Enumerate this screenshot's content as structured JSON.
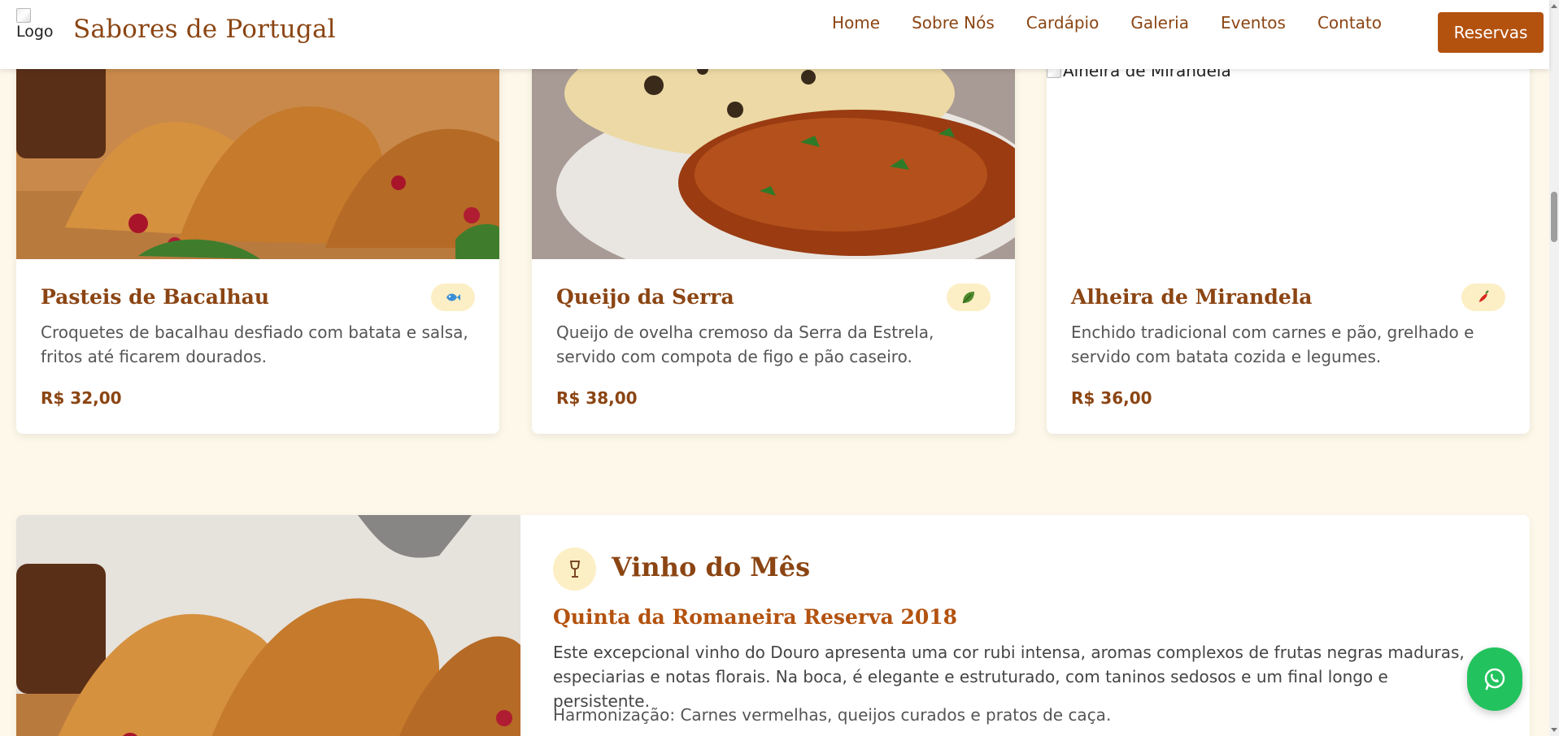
{
  "header": {
    "logo_alt": "Logo",
    "brand": "Sabores de Portugal",
    "nav": [
      "Home",
      "Sobre Nós",
      "Cardápio",
      "Galeria",
      "Eventos",
      "Contato"
    ],
    "cta": "Reservas"
  },
  "dishes": [
    {
      "name": "Pasteis de Bacalhau",
      "description": "Croquetes de bacalhau desfiado com batata e salsa, fritos até ficarem dourados.",
      "price": "R$ 32,00",
      "badge_icon": "fish-icon",
      "image_alt": "Pasteis de Bacalhau"
    },
    {
      "name": "Queijo da Serra",
      "description": "Queijo de ovelha cremoso da Serra da Estrela, servido com compota de figo e pão caseiro.",
      "price": "R$ 38,00",
      "badge_icon": "leaf-icon",
      "image_alt": "Queijo da Serra"
    },
    {
      "name": "Alheira de Mirandela",
      "description": "Enchido tradicional com carnes e pão, grelhado e servido com batata cozida e legumes.",
      "price": "R$ 36,00",
      "badge_icon": "chili-pepper-icon",
      "image_alt": "Alheira de Mirandela"
    }
  ],
  "wine": {
    "heading": "Vinho do Mês",
    "name": "Quinta da Romaneira Reserva 2018",
    "description": "Este excepcional vinho do Douro apresenta uma cor rubi intensa, aromas complexos de frutas negras maduras, especiarias e notas florais. Na boca, é elegante e estruturado, com taninos sedosos e um final longo e persistente.",
    "pairing": "Harmonização: Carnes vermelhas, queijos curados e pratos de caça.",
    "icon": "wine-glass-icon"
  },
  "colors": {
    "brand": "#8b4513",
    "accent": "#b3520f",
    "background": "#fdf8e9",
    "badge": "#fdefc5",
    "whatsapp": "#22c35e"
  }
}
